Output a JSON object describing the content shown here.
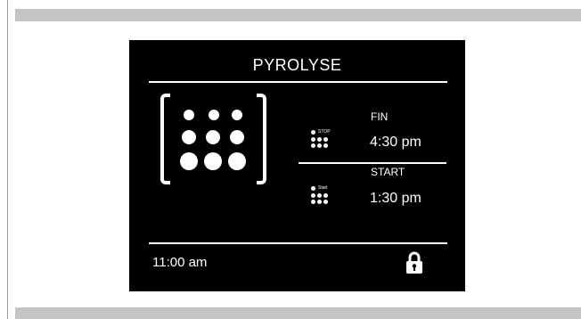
{
  "screen": {
    "title": "PYROLYSE",
    "fin": {
      "label": "FIN",
      "badge": "STOP",
      "time": "4:30 pm"
    },
    "start": {
      "label": "START",
      "badge": "Start",
      "time": "1:30 pm"
    },
    "clock": "11:00 am",
    "icons": {
      "burner_grid": "burner-grid-icon",
      "stop_grid": "stop-grid-icon",
      "start_grid": "start-grid-icon",
      "lock": "lock-icon"
    }
  },
  "colors": {
    "screen_background": "#000000",
    "foreground": "#ffffff",
    "band": "#c4c4c4"
  }
}
